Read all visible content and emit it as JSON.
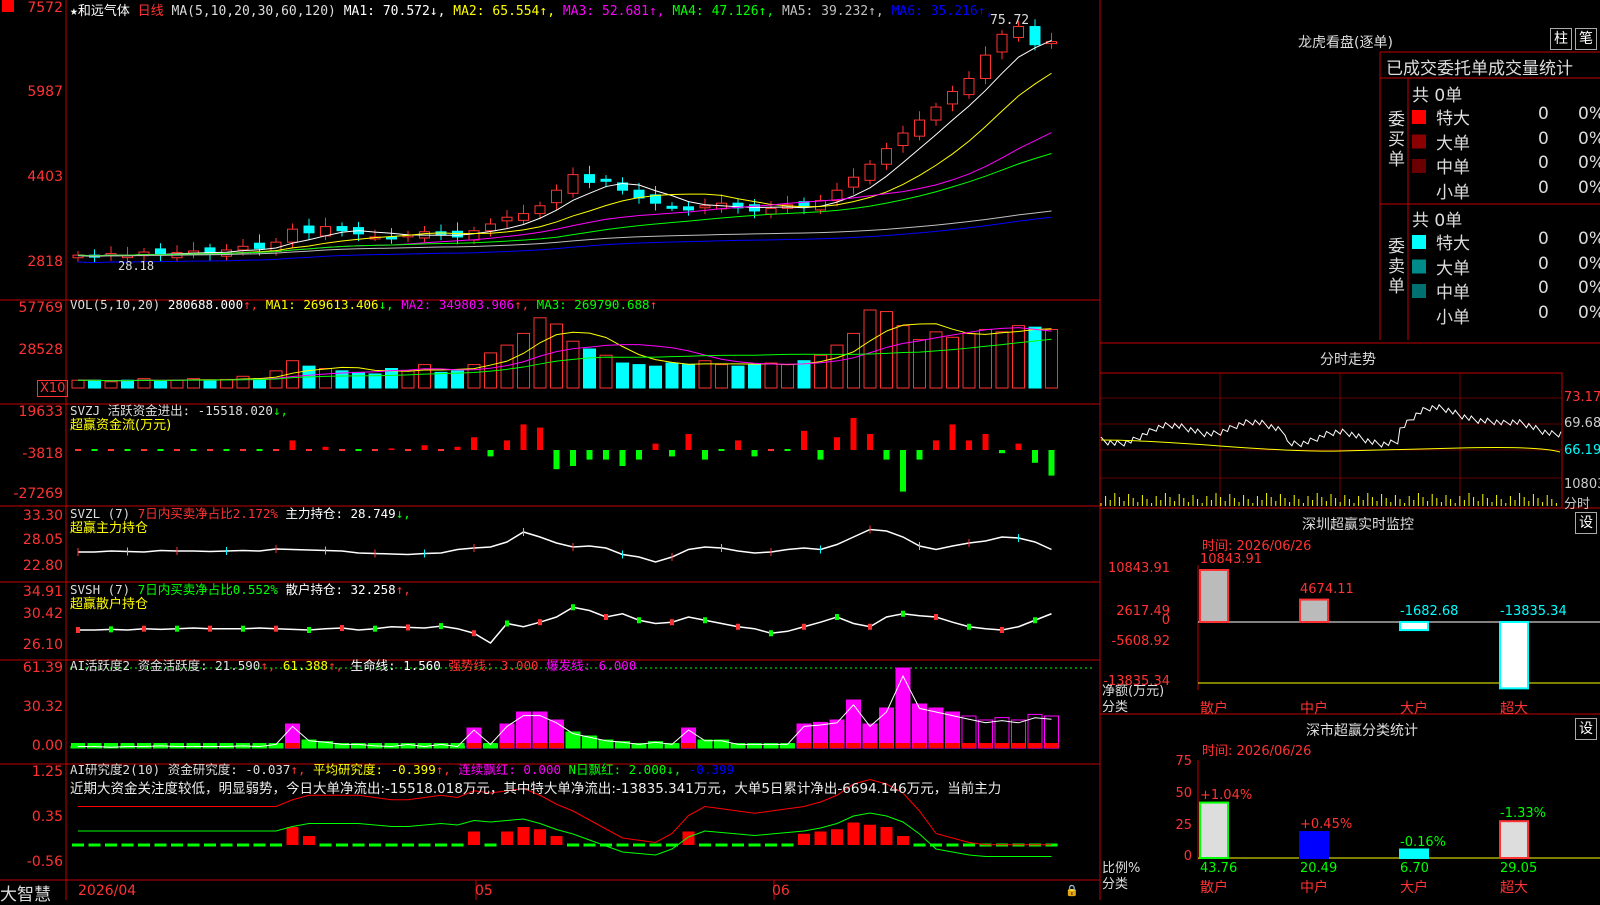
{
  "stock": {
    "name": "★和远气体",
    "period": "日线",
    "ma_def": "MA(5,10,20,30,60,120)"
  },
  "ma_legend": [
    {
      "label": "MA1: 70.572",
      "arrow": "↓",
      "color": "#ffffff"
    },
    {
      "label": "MA2: 65.554",
      "arrow": "↑",
      "color": "#ffff00"
    },
    {
      "label": "MA3: 52.681",
      "arrow": "↑",
      "color": "#ff00ff"
    },
    {
      "label": "MA4: 47.126",
      "arrow": "↑",
      "color": "#00ff00"
    },
    {
      "label": "MA5: 39.232",
      "arrow": "↑",
      "color": "#c0c0c0"
    },
    {
      "label": "MA6: 35.216",
      "arrow": "↑",
      "color": "#0000ff"
    }
  ],
  "price_axis": [
    "7572",
    "5987",
    "4403",
    "2818"
  ],
  "price_marks": {
    "high": "75.72",
    "low": "28.18"
  },
  "vol_panel": {
    "head": "VOL(5,10,20)",
    "value": "280688.000",
    "ma1": "MA1: 269613.406",
    "ma2": "MA2: 349803.906",
    "ma3": "MA3: 269790.688",
    "axis": [
      "57769",
      "28528"
    ],
    "unit": "X10"
  },
  "svzj_panel": {
    "head": "SVZJ  活跃资金进出: -15518.020",
    "sub": "超赢资金流(万元)",
    "axis": [
      "19633",
      "-3818",
      "-27269"
    ]
  },
  "svzl_panel": {
    "head": "SVZL (7)",
    "pct": "7日内买卖净占比2.172%",
    "hold": "主力持仓: 28.749",
    "sub": "超赢主力持仓",
    "axis": [
      "33.30",
      "28.05",
      "22.80"
    ]
  },
  "svsh_panel": {
    "head": "SVSH (7)",
    "pct": "7日内买卖净占比0.552%",
    "hold": "散户持仓: 32.258",
    "sub": "超赢散户持仓",
    "axis": [
      "34.91",
      "30.42",
      "26.10"
    ]
  },
  "ai1_panel": {
    "head": "AI活跃度2 资金活跃度: 21.590",
    "v2": "61.388",
    "v3": "生命线: 1.560",
    "v4": "强势线: 3.000",
    "v5": "爆发线: 6.000",
    "axis": [
      "61.39",
      "30.32",
      "0.00"
    ]
  },
  "ai2_panel": {
    "head": "AI研究度2(10) 资金研究度: -0.037",
    "v2": "平均研究度: -0.399",
    "v3": "连续飘红: 0.000",
    "v4": "N日飘红: 2.000",
    "v5": "-0.399",
    "axis": [
      "1.25",
      "0.35",
      "-0.56"
    ],
    "note": "近期大资金关注度较低，明显弱势，今日大单净流出:-15518.018万元，其中特大单净流出:-13835.341万元，大单5日累计净出-6694.146万元，当前主力"
  },
  "date_axis": [
    "2026/04",
    "05",
    "06"
  ],
  "brand": "大智慧",
  "lhb": {
    "title": "龙虎看盘(逐单)",
    "btn1": "柱",
    "btn2": "笔",
    "header": "已成交委托单成交量统计",
    "buy_label": "委买单",
    "sell_label": "委卖单",
    "buy_total": "共 0单",
    "sell_total": "共 0单",
    "buy_rows": [
      {
        "name": "特大",
        "n": "0",
        "p": "0%",
        "c": "#ff0000"
      },
      {
        "name": "大单",
        "n": "0",
        "p": "0%",
        "c": "#8b0000"
      },
      {
        "name": "中单",
        "n": "0",
        "p": "0%",
        "c": "#6b0000"
      },
      {
        "name": "小单",
        "n": "0",
        "p": "0%",
        "c": "#000000"
      }
    ],
    "sell_rows": [
      {
        "name": "特大",
        "n": "0",
        "p": "0%",
        "c": "#00ffff"
      },
      {
        "name": "大单",
        "n": "0",
        "p": "0%",
        "c": "#008b8b"
      },
      {
        "name": "中单",
        "n": "0",
        "p": "0%",
        "c": "#007070"
      },
      {
        "name": "小单",
        "n": "0",
        "p": "0%",
        "c": "#000000"
      }
    ]
  },
  "intraday": {
    "title": "分时走势",
    "axis": [
      "73.17",
      "69.68",
      "66.19",
      "10803",
      "分时"
    ]
  },
  "szmon": {
    "title": "深圳超赢实时监控",
    "btn": "设",
    "time": "时间: 2026/06/26",
    "axis": [
      "10843.91",
      "2617.49",
      "0",
      "-5608.92",
      "-13835.34"
    ],
    "ylabel": "净额(万元)",
    "xlabel": "分类",
    "bars": [
      {
        "cat": "散户",
        "value": 10843.91,
        "label": "10843.91"
      },
      {
        "cat": "中户",
        "value": 4674.11,
        "label": "4674.11"
      },
      {
        "cat": "大户",
        "value": -1682.68,
        "label": "-1682.68"
      },
      {
        "cat": "超大",
        "value": -13835.34,
        "label": "-13835.34"
      }
    ]
  },
  "szcls": {
    "title": "深市超赢分类统计",
    "btn": "设",
    "time": "时间: 2026/06/26",
    "axis": [
      "75",
      "50",
      "25",
      "0"
    ],
    "ylabel": "比例%",
    "xlabel": "分类",
    "bars": [
      {
        "cat": "散户",
        "value": 43.76,
        "label": "43.76",
        "chg": "+1.04%"
      },
      {
        "cat": "中户",
        "value": 20.49,
        "label": "20.49",
        "chg": "+0.45%"
      },
      {
        "cat": "大户",
        "value": 6.7,
        "label": "6.70",
        "chg": "-0.16%"
      },
      {
        "cat": "超大",
        "value": 29.05,
        "label": "29.05",
        "chg": "-1.33%"
      }
    ]
  },
  "colors": {
    "up": "#ff3232",
    "down": "#00ffff",
    "grid": "#c00000"
  }
}
